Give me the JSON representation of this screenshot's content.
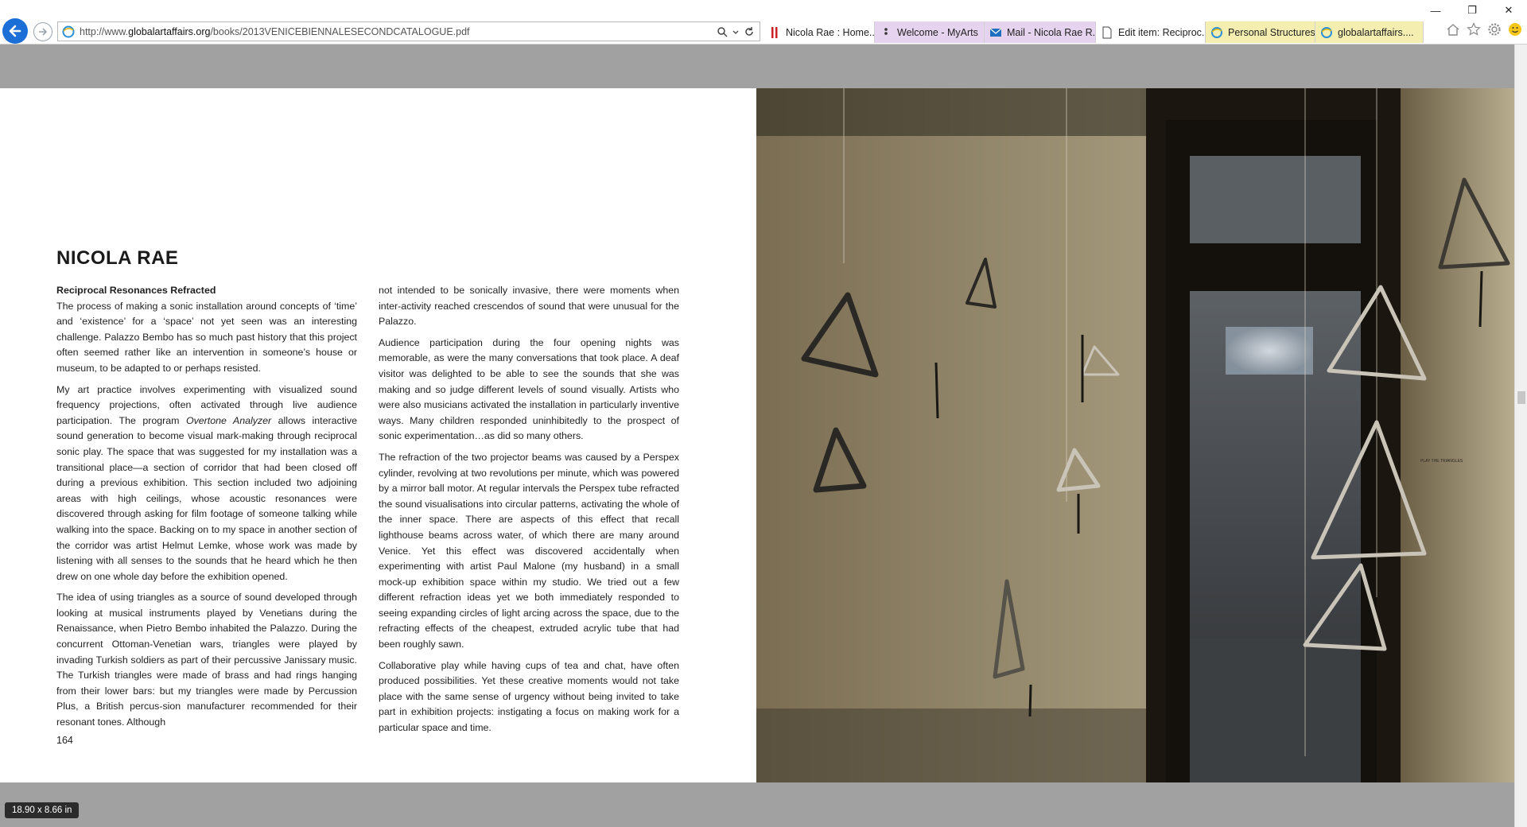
{
  "browser": {
    "url_prefix": "http://www.",
    "url_domain": "globalartaffairs.org",
    "url_path": "/books/2013VENICEBIENNALESECONDCATALOGUE.pdf",
    "tabs": [
      {
        "label": "Nicola Rae : Home...",
        "icon": "red-bars-icon"
      },
      {
        "label": "Welcome - MyArts",
        "icon": "dots-icon"
      },
      {
        "label": "Mail - Nicola Rae R...",
        "icon": "mail-icon"
      },
      {
        "label": "Edit item: Reciproc...",
        "icon": "page-icon"
      },
      {
        "label": "Personal Structures...",
        "icon": "ie-icon"
      },
      {
        "label": "globalartaffairs....",
        "icon": "ie-icon",
        "active": true
      }
    ]
  },
  "document": {
    "title": "NICOLA RAE",
    "heading": "Reciprocal Resonances Refracted",
    "col1": {
      "p1": "The process of making a sonic installation around concepts of ‘time’ and ‘existence’ for a ‘space’ not yet seen was an interesting challenge. Palazzo Bembo has so much past history that this project often seemed rather like an intervention in someone’s house or museum, to be adapted to or perhaps resisted.",
      "p2_a": "My art practice involves experimenting with visualized sound frequency projections, often activated through live audience participation. The program ",
      "p2_em": "Overtone Analyzer",
      "p2_b": " allows interactive sound generation to become visual mark-making through reciprocal sonic play. The space that was suggested for my installation was a transitional place—a section of corridor that had been closed off during a previous exhibition. This section included two adjoining areas with high ceilings, whose acoustic resonances were discovered through asking for film footage of someone talking while walking into the space. Backing on to my space in another section of the corridor was artist Helmut Lemke, whose work was made by listening with all senses to the sounds that he heard which he then drew on one whole day before the exhibition opened.",
      "p3": "The idea of using triangles as a source of sound developed through looking at musical instruments played by Venetians during the Renaissance, when Pietro Bembo inhabited the Palazzo. During the concurrent Ottoman-Venetian wars, triangles were played by invading Turkish soldiers as part of their percussive Janissary music. The Turkish triangles were made of brass and had rings hanging from their lower bars: but my triangles were made by Percussion Plus, a British percus-sion manufacturer recommended for their resonant tones. Although"
    },
    "col2": {
      "p1": "not intended to be sonically invasive, there were moments when inter-activity reached crescendos of sound that were unusual for the Palazzo.",
      "p2": "Audience participation during the four opening nights was memorable, as were the many conversations that took place. A deaf visitor was delighted to be able to see the sounds that she was making and so judge different levels of sound visually. Artists who were also musicians activated the installation in particularly inventive ways. Many children responded uninhibitedly to the prospect of sonic experimentation…as did so many others.",
      "p3": "The refraction of the two projector beams was caused by a Perspex cylinder, revolving at two revolutions per minute, which was powered by a mirror ball motor. At regular intervals the Perspex tube refracted the sound visualisations into circular patterns, activating the whole of the inner space. There are aspects of this effect that recall lighthouse beams across water, of which there are many around Venice. Yet this effect was discovered accidentally when experimenting with artist Paul Malone (my husband) in a small mock-up exhibition space within my studio. We tried out a few different refraction ideas yet we both immediately responded to seeing expanding circles of light arcing across the space, due to the refracting effects of the cheapest, extruded acrylic tube that had been roughly sawn.",
      "p4": "Collaborative play while having cups of tea and chat, have often produced possibilities. Yet these creative moments would not take place with the same sense of urgency without being invited to take part in exhibition projects: instigating a focus on making work for a particular space and time."
    },
    "page_number": "164"
  },
  "status": {
    "page_size": "18.90 x 8.66 in"
  },
  "colors": {
    "accent": "#1d6fd8",
    "gray": "#a1a1a1"
  }
}
